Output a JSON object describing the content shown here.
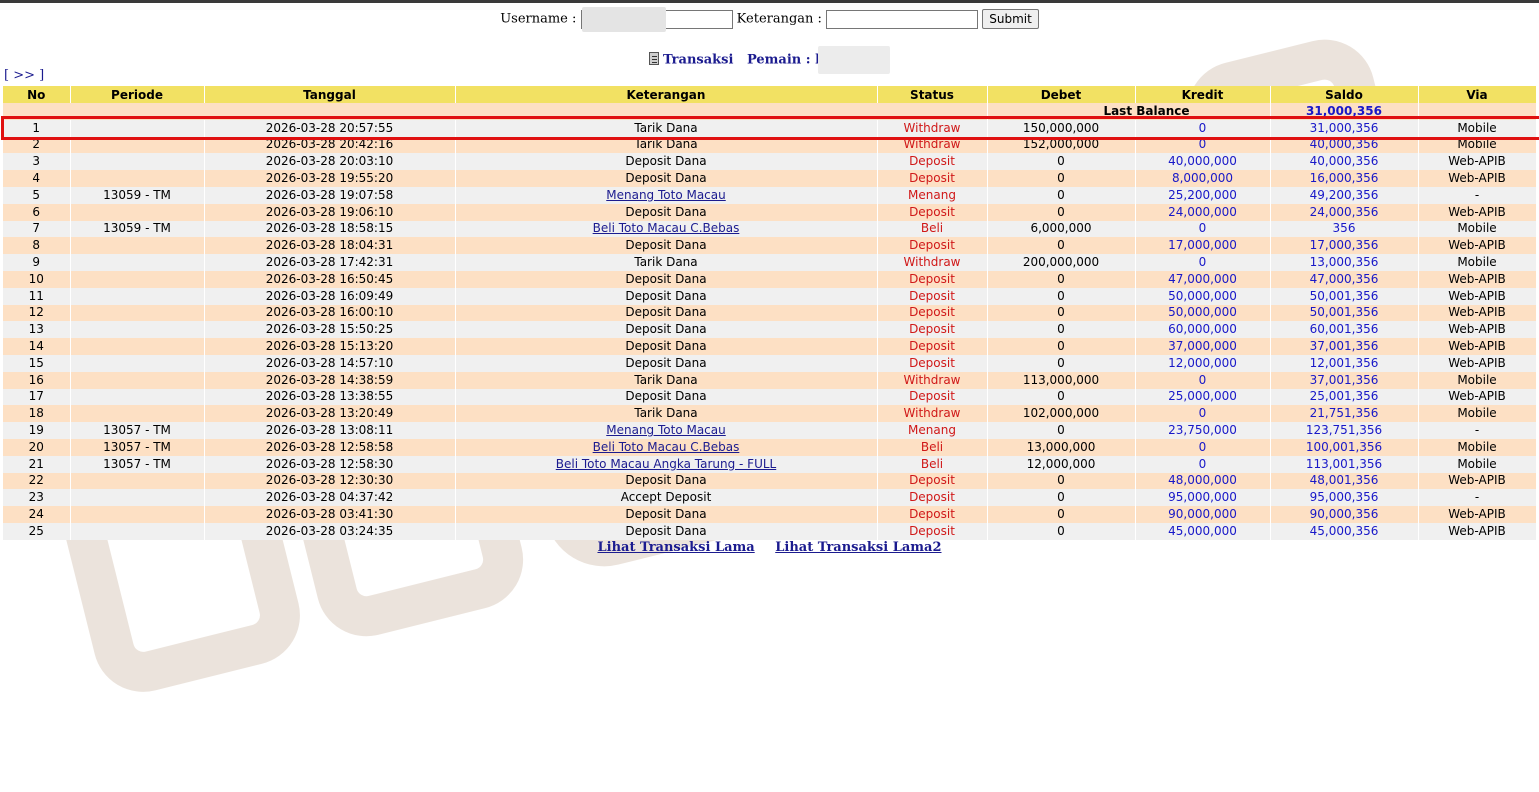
{
  "filter": {
    "username_label": "Username :",
    "keterangan_label": "Keterangan :",
    "submit_label": "Submit"
  },
  "title": {
    "transaksi": "Transaksi",
    "pemain": "Pemain : l"
  },
  "nav_link": "[ >> ]",
  "table": {
    "headers": [
      "No",
      "Periode",
      "Tanggal",
      "Keterangan",
      "Status",
      "Debet",
      "Kredit",
      "Saldo",
      "Via"
    ],
    "last_balance_label": "Last Balance",
    "last_balance_value": "31,000,356",
    "rows": [
      {
        "no": "1",
        "periode": "",
        "tanggal": "2026-03-28 20:57:55",
        "keterangan": "Tarik Dana",
        "status": "Withdraw",
        "debet": "150,000,000",
        "kredit": "0",
        "saldo": "31,000,356",
        "via": "Mobile",
        "link": false
      },
      {
        "no": "2",
        "periode": "",
        "tanggal": "2026-03-28 20:42:16",
        "keterangan": "Tarik Dana",
        "status": "Withdraw",
        "debet": "152,000,000",
        "kredit": "0",
        "saldo": "40,000,356",
        "via": "Mobile",
        "link": false
      },
      {
        "no": "3",
        "periode": "",
        "tanggal": "2026-03-28 20:03:10",
        "keterangan": "Deposit Dana",
        "status": "Deposit",
        "debet": "0",
        "kredit": "40,000,000",
        "saldo": "40,000,356",
        "via": "Web-APIB",
        "link": false
      },
      {
        "no": "4",
        "periode": "",
        "tanggal": "2026-03-28 19:55:20",
        "keterangan": "Deposit Dana",
        "status": "Deposit",
        "debet": "0",
        "kredit": "8,000,000",
        "saldo": "16,000,356",
        "via": "Web-APIB",
        "link": false
      },
      {
        "no": "5",
        "periode": "13059 - TM",
        "tanggal": "2026-03-28 19:07:58",
        "keterangan": "Menang Toto Macau",
        "status": "Menang",
        "debet": "0",
        "kredit": "25,200,000",
        "saldo": "49,200,356",
        "via": "-",
        "link": true
      },
      {
        "no": "6",
        "periode": "",
        "tanggal": "2026-03-28 19:06:10",
        "keterangan": "Deposit Dana",
        "status": "Deposit",
        "debet": "0",
        "kredit": "24,000,000",
        "saldo": "24,000,356",
        "via": "Web-APIB",
        "link": false
      },
      {
        "no": "7",
        "periode": "13059 - TM",
        "tanggal": "2026-03-28 18:58:15",
        "keterangan": "Beli Toto Macau C.Bebas",
        "status": "Beli",
        "debet": "6,000,000",
        "kredit": "0",
        "saldo": "356",
        "via": "Mobile",
        "link": true
      },
      {
        "no": "8",
        "periode": "",
        "tanggal": "2026-03-28 18:04:31",
        "keterangan": "Deposit Dana",
        "status": "Deposit",
        "debet": "0",
        "kredit": "17,000,000",
        "saldo": "17,000,356",
        "via": "Web-APIB",
        "link": false
      },
      {
        "no": "9",
        "periode": "",
        "tanggal": "2026-03-28 17:42:31",
        "keterangan": "Tarik Dana",
        "status": "Withdraw",
        "debet": "200,000,000",
        "kredit": "0",
        "saldo": "13,000,356",
        "via": "Mobile",
        "link": false
      },
      {
        "no": "10",
        "periode": "",
        "tanggal": "2026-03-28 16:50:45",
        "keterangan": "Deposit Dana",
        "status": "Deposit",
        "debet": "0",
        "kredit": "47,000,000",
        "saldo": "47,000,356",
        "via": "Web-APIB",
        "link": false
      },
      {
        "no": "11",
        "periode": "",
        "tanggal": "2026-03-28 16:09:49",
        "keterangan": "Deposit Dana",
        "status": "Deposit",
        "debet": "0",
        "kredit": "50,000,000",
        "saldo": "50,001,356",
        "via": "Web-APIB",
        "link": false
      },
      {
        "no": "12",
        "periode": "",
        "tanggal": "2026-03-28 16:00:10",
        "keterangan": "Deposit Dana",
        "status": "Deposit",
        "debet": "0",
        "kredit": "50,000,000",
        "saldo": "50,001,356",
        "via": "Web-APIB",
        "link": false
      },
      {
        "no": "13",
        "periode": "",
        "tanggal": "2026-03-28 15:50:25",
        "keterangan": "Deposit Dana",
        "status": "Deposit",
        "debet": "0",
        "kredit": "60,000,000",
        "saldo": "60,001,356",
        "via": "Web-APIB",
        "link": false
      },
      {
        "no": "14",
        "periode": "",
        "tanggal": "2026-03-28 15:13:20",
        "keterangan": "Deposit Dana",
        "status": "Deposit",
        "debet": "0",
        "kredit": "37,000,000",
        "saldo": "37,001,356",
        "via": "Web-APIB",
        "link": false
      },
      {
        "no": "15",
        "periode": "",
        "tanggal": "2026-03-28 14:57:10",
        "keterangan": "Deposit Dana",
        "status": "Deposit",
        "debet": "0",
        "kredit": "12,000,000",
        "saldo": "12,001,356",
        "via": "Web-APIB",
        "link": false
      },
      {
        "no": "16",
        "periode": "",
        "tanggal": "2026-03-28 14:38:59",
        "keterangan": "Tarik Dana",
        "status": "Withdraw",
        "debet": "113,000,000",
        "kredit": "0",
        "saldo": "37,001,356",
        "via": "Mobile",
        "link": false
      },
      {
        "no": "17",
        "periode": "",
        "tanggal": "2026-03-28 13:38:55",
        "keterangan": "Deposit Dana",
        "status": "Deposit",
        "debet": "0",
        "kredit": "25,000,000",
        "saldo": "25,001,356",
        "via": "Web-APIB",
        "link": false
      },
      {
        "no": "18",
        "periode": "",
        "tanggal": "2026-03-28 13:20:49",
        "keterangan": "Tarik Dana",
        "status": "Withdraw",
        "debet": "102,000,000",
        "kredit": "0",
        "saldo": "21,751,356",
        "via": "Mobile",
        "link": false
      },
      {
        "no": "19",
        "periode": "13057 - TM",
        "tanggal": "2026-03-28 13:08:11",
        "keterangan": "Menang Toto Macau",
        "status": "Menang",
        "debet": "0",
        "kredit": "23,750,000",
        "saldo": "123,751,356",
        "via": "-",
        "link": true
      },
      {
        "no": "20",
        "periode": "13057 - TM",
        "tanggal": "2026-03-28 12:58:58",
        "keterangan": "Beli Toto Macau C.Bebas",
        "status": "Beli",
        "debet": "13,000,000",
        "kredit": "0",
        "saldo": "100,001,356",
        "via": "Mobile",
        "link": true
      },
      {
        "no": "21",
        "periode": "13057 - TM",
        "tanggal": "2026-03-28 12:58:30",
        "keterangan": "Beli Toto Macau Angka Tarung - FULL",
        "status": "Beli",
        "debet": "12,000,000",
        "kredit": "0",
        "saldo": "113,001,356",
        "via": "Mobile",
        "link": true
      },
      {
        "no": "22",
        "periode": "",
        "tanggal": "2026-03-28 12:30:30",
        "keterangan": "Deposit Dana",
        "status": "Deposit",
        "debet": "0",
        "kredit": "48,000,000",
        "saldo": "48,001,356",
        "via": "Web-APIB",
        "link": false
      },
      {
        "no": "23",
        "periode": "",
        "tanggal": "2026-03-28 04:37:42",
        "keterangan": "Accept Deposit",
        "status": "Deposit",
        "debet": "0",
        "kredit": "95,000,000",
        "saldo": "95,000,356",
        "via": "-",
        "link": false
      },
      {
        "no": "24",
        "periode": "",
        "tanggal": "2026-03-28 03:41:30",
        "keterangan": "Deposit Dana",
        "status": "Deposit",
        "debet": "0",
        "kredit": "90,000,000",
        "saldo": "90,000,356",
        "via": "Web-APIB",
        "link": false
      },
      {
        "no": "25",
        "periode": "",
        "tanggal": "2026-03-28 03:24:35",
        "keterangan": "Deposit Dana",
        "status": "Deposit",
        "debet": "0",
        "kredit": "45,000,000",
        "saldo": "45,000,356",
        "via": "Web-APIB",
        "link": false
      }
    ]
  },
  "footer": {
    "link1": "Lihat Transaksi Lama",
    "link2": "Lihat Transaksi Lama2"
  },
  "colors": {
    "header_bg": "#f2e163",
    "row_odd": "#f0f0f0",
    "row_even": "#fde0c4",
    "status_red": "#d01818",
    "amount_blue": "#1818c8",
    "link_navy": "#1b1b8f",
    "highlight_outline": "#e01010"
  }
}
